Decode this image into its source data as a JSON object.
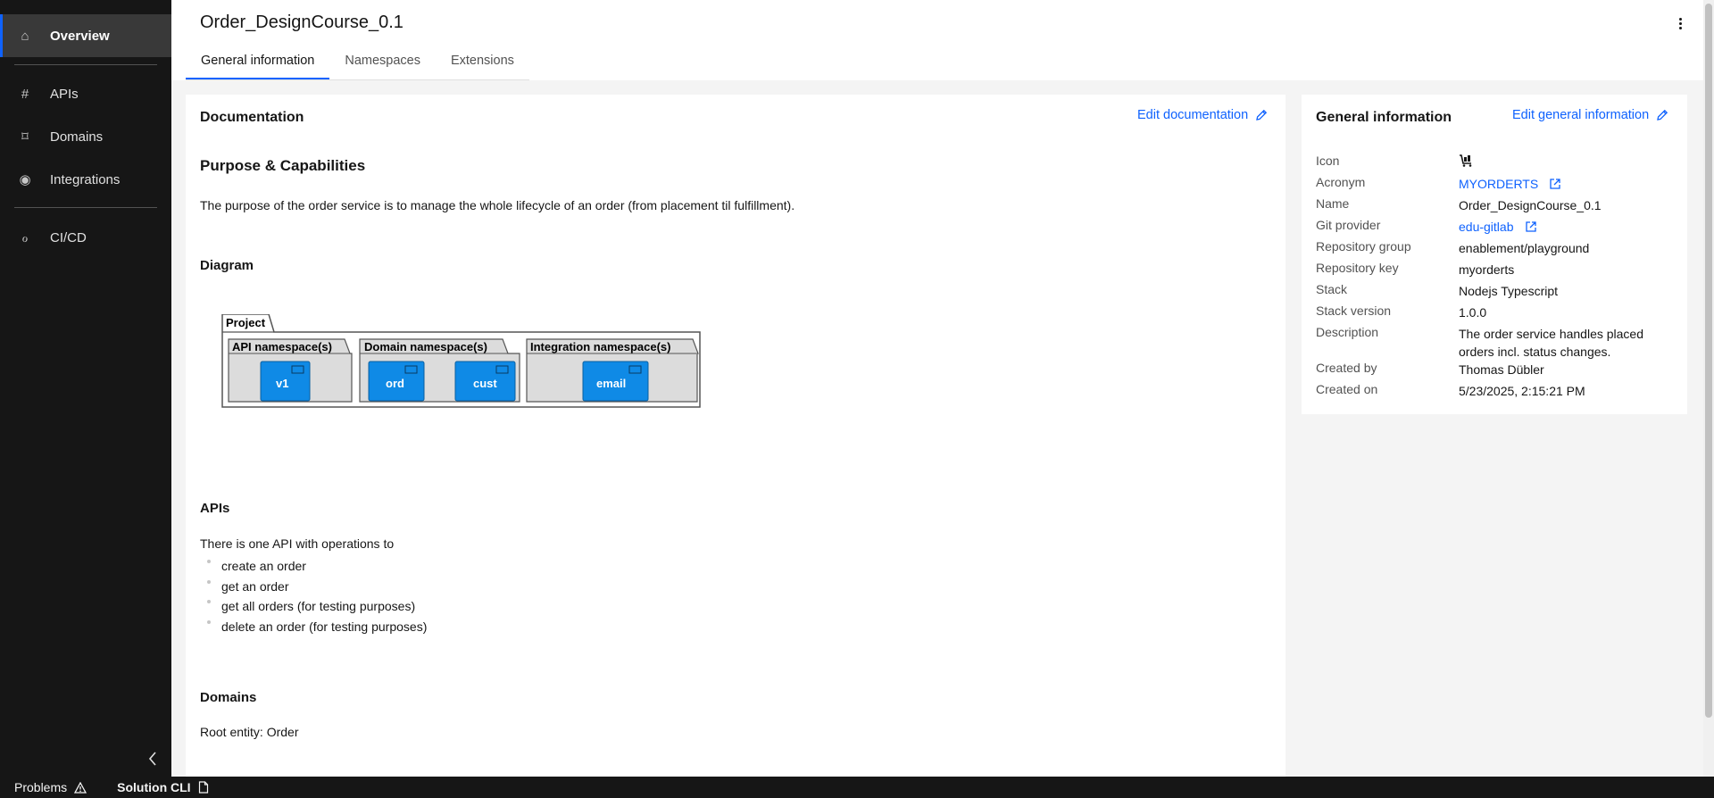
{
  "sidebar": {
    "items": [
      {
        "label": "Overview",
        "icon": "home-icon",
        "glyph": "⌂"
      },
      {
        "label": "APIs",
        "icon": "hashtag-icon",
        "glyph": "#"
      },
      {
        "label": "Domains",
        "icon": "domain-icon",
        "glyph": "⌑"
      },
      {
        "label": "Integrations",
        "icon": "radio-target-icon",
        "glyph": "◉"
      },
      {
        "label": "CI/CD",
        "icon": "pipeline-icon",
        "glyph": "ℴ"
      }
    ]
  },
  "header": {
    "title": "Order_DesignCourse_0.1",
    "tabs": [
      {
        "label": "General information"
      },
      {
        "label": "Namespaces"
      },
      {
        "label": "Extensions"
      }
    ]
  },
  "documentation": {
    "heading": "Documentation",
    "edit_label": "Edit documentation",
    "purpose_heading": "Purpose & Capabilities",
    "purpose_text": "The purpose of the order service is to manage the whole lifecycle of an order (from placement til fulfillment).",
    "diagram_heading": "Diagram",
    "diagram": {
      "project_label": "Project",
      "groups": [
        {
          "label": "API namespace(s)",
          "components": [
            "v1"
          ]
        },
        {
          "label": "Domain namespace(s)",
          "components": [
            "ord",
            "cust"
          ]
        },
        {
          "label": "Integration namespace(s)",
          "components": [
            "email"
          ]
        }
      ]
    },
    "apis_heading": "APIs",
    "apis_text": "There is one API with operations to",
    "apis_items": [
      "create an order",
      "get an order",
      "get all orders (for testing purposes)",
      "delete an order (for testing purposes)"
    ],
    "domains_heading": "Domains",
    "domains_text": "Root entity: Order"
  },
  "general_info": {
    "heading": "General information",
    "edit_label": "Edit general information",
    "icon_label": "Icon",
    "acronym_label": "Acronym",
    "acronym_value": "MYORDERTS",
    "name_label": "Name",
    "name_value": "Order_DesignCourse_0.1",
    "git_label": "Git provider",
    "git_value": "edu-gitlab",
    "repo_group_label": "Repository group",
    "repo_group_value": "enablement/playground",
    "repo_key_label": "Repository key",
    "repo_key_value": "myorderts",
    "stack_label": "Stack",
    "stack_value": "Nodejs Typescript",
    "stack_version_label": "Stack version",
    "stack_version_value": "1.0.0",
    "description_label": "Description",
    "description_value": "The order service handles placed orders incl. status changes.",
    "created_by_label": "Created by",
    "created_by_value": "Thomas Dübler",
    "created_on_label": "Created on",
    "created_on_value": "5/23/2025, 2:15:21 PM"
  },
  "statusbar": {
    "problems_label": "Problems",
    "cli_label": "Solution CLI"
  },
  "colors": {
    "accent": "#0f62fe",
    "sidebar_bg": "#161616",
    "component_fill": "#0f8ae6"
  }
}
